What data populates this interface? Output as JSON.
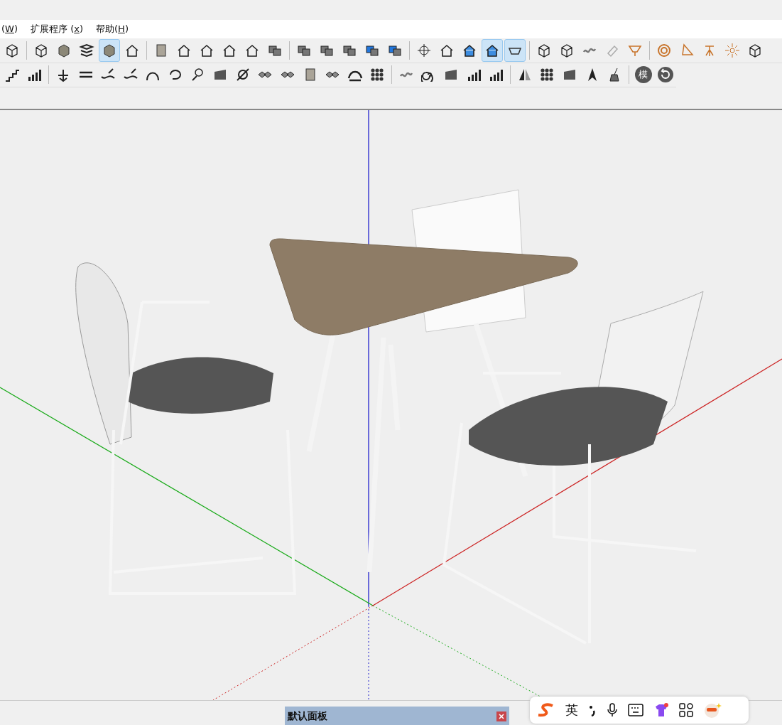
{
  "menu": [
    {
      "label": "(W)"
    },
    {
      "label": "扩展程序 (x)"
    },
    {
      "label": "帮助(H)"
    }
  ],
  "toolbar_row_1": [
    {
      "selected": false
    },
    {
      "selected": false
    },
    {
      "selected": false
    },
    {
      "selected": false
    },
    {
      "selected": true
    },
    {
      "selected": false
    },
    {
      "selected": false
    },
    {
      "selected": false
    },
    {
      "selected": false
    },
    {
      "selected": false
    },
    {
      "selected": false
    },
    {
      "selected": false
    },
    {
      "selected": false
    },
    {
      "selected": false
    },
    {
      "selected": false
    },
    {
      "selected": false
    },
    {
      "selected": false
    },
    {
      "selected": false
    },
    {
      "selected": false
    },
    {
      "selected": false
    },
    {
      "selected": true
    },
    {
      "selected": true
    },
    {
      "selected": false
    },
    {
      "selected": false
    },
    {
      "selected": false
    },
    {
      "selected": false
    },
    {
      "selected": false
    },
    {
      "selected": false
    },
    {
      "selected": false
    },
    {
      "selected": false
    },
    {
      "selected": false
    },
    {
      "selected": false
    }
  ],
  "plugin_badge": "模",
  "panel": {
    "title": "默认面板"
  },
  "ime_bar": {
    "language": "英"
  }
}
